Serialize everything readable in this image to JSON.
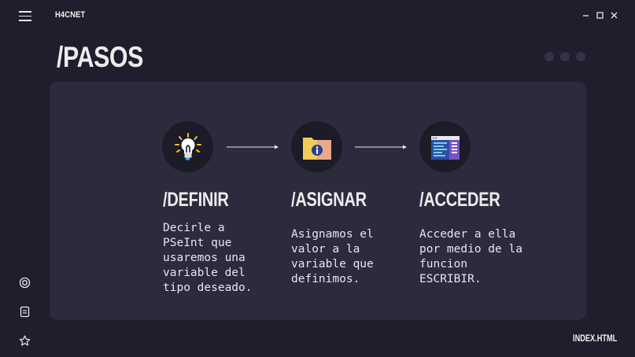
{
  "header": {
    "app_title": "H4CNET"
  },
  "page": {
    "title": "/PASOS"
  },
  "steps": [
    {
      "title": "/DEFINIR",
      "desc": "Decirle a\nPSeInt que\nusaremos una\nvariable del\ntipo deseado.",
      "icon": "lightbulb-icon"
    },
    {
      "title": "/ASIGNAR",
      "desc": "Asignamos el\nvalor a la\nvariable que\ndefinimos.",
      "icon": "folder-info-icon"
    },
    {
      "title": "/ACCEDER",
      "desc": "Acceder a ella\npor medio de la\nfuncion\nESCRIBIR.",
      "icon": "window-list-icon"
    }
  ],
  "sidebar": {
    "icons": [
      "target-icon",
      "document-icon",
      "star-icon"
    ]
  },
  "footer": {
    "file_label": "INDEX.HTML"
  },
  "colors": {
    "background": "#1f1e2c",
    "card": "#2c2b3e",
    "icon_circle": "#1c1b28"
  }
}
